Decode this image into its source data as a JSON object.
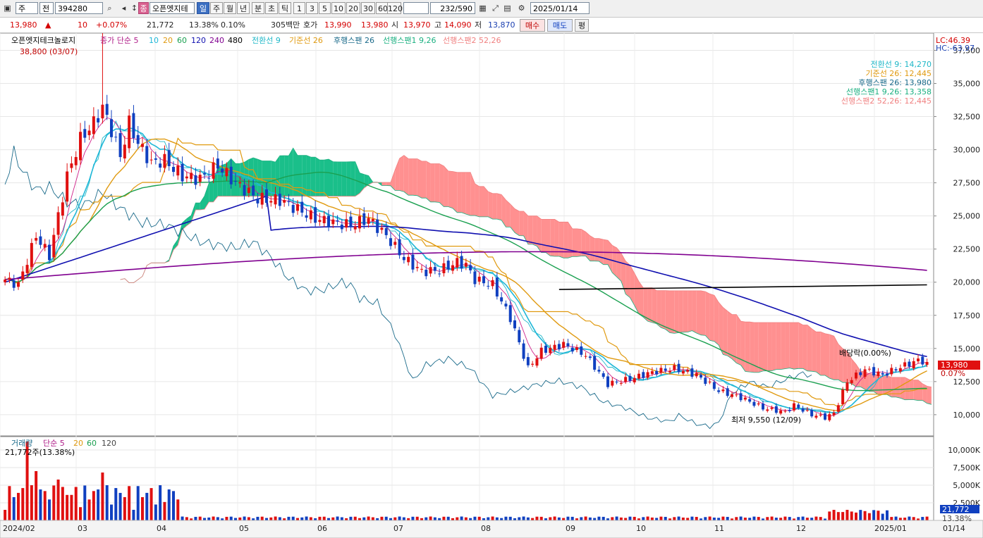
{
  "toolbar": {
    "market": "주",
    "type": "전",
    "code": "394280",
    "name": "오픈엣지테",
    "period_tabs": [
      "일",
      "주",
      "월",
      "년",
      "분",
      "초",
      "틱"
    ],
    "intervals": [
      "1",
      "3",
      "5",
      "10",
      "20",
      "30",
      "60",
      "120"
    ],
    "count": "232",
    "total": "/590",
    "date": "2025/01/14"
  },
  "quote": {
    "price": "13,980",
    "arrow": "▲",
    "change": "10",
    "change_pct": "+0.07%",
    "volume": "21,772",
    "turnover_pct": "13.38%",
    "ratio": "0.10%",
    "amount": "305백만",
    "ask_label": "호가",
    "ask1": "13,990",
    "ask2": "13,980",
    "open_label": "시",
    "open": "13,970",
    "high_label": "고",
    "high": "14,090",
    "low_label": "저",
    "low": "13,870",
    "buy": "매수",
    "sell": "매도",
    "eval": "평"
  },
  "legend": {
    "name": "오픈엣지테크놀로지",
    "ma_label": "종가 단순 5",
    "ma_periods": [
      "10",
      "20",
      "60",
      "120",
      "240",
      "480"
    ],
    "ichimoku": [
      "전환선 9",
      "기준선 26",
      "후행스팬 26",
      "선행스팬1 9,26",
      "선행스팬2 52,26"
    ],
    "max_marker": "38,800 (03/07)",
    "min_marker": "최저 9,550 (12/09)",
    "dividend": "배당락(0.00%)",
    "lc": "LC:46.39",
    "hc": "HC:-63.97"
  },
  "ichimoku_values": [
    {
      "label": "전환선 9: 14,270",
      "color": "#20b8c8"
    },
    {
      "label": "기준선 26: 12,445",
      "color": "#e09a10"
    },
    {
      "label": "후행스팬 26: 13,980",
      "color": "#1a6a8a"
    },
    {
      "label": "선행스팬1 9,26: 13,358",
      "color": "#1ab080"
    },
    {
      "label": "선행스팬2 52,26: 12,445",
      "color": "#f08080"
    }
  ],
  "volume_legend": {
    "label": "거래량",
    "ma": "단순 5",
    "periods": [
      "20",
      "60",
      "120"
    ],
    "current": "21,772주(13.38%)",
    "current_value": "21,772",
    "current_pct": "13.38%"
  },
  "price_tags": {
    "current": "13,980",
    "pct": "0.07%"
  },
  "colors": {
    "up": "#e01010",
    "down": "#1040c0",
    "cloud_up": "#1abf8a",
    "cloud_down": "#ff9090"
  },
  "chart_data": {
    "type": "candlestick",
    "price_axis": {
      "min": 8400,
      "max": 38800,
      "ticks": [
        "37,500",
        "35,000",
        "32,500",
        "30,000",
        "27,500",
        "25,000",
        "22,500",
        "20,000",
        "17,500",
        "15,000",
        "12,500",
        "10,000"
      ]
    },
    "volume_axis": {
      "max": 11500,
      "ticks": [
        "10,000K",
        "7,500K",
        "5,000K",
        "2,500K"
      ]
    },
    "x_labels": [
      "2024/02",
      "03",
      "04",
      "05",
      "06",
      "07",
      "08",
      "09",
      "10",
      "11",
      "12",
      "2025/01",
      "01/14"
    ],
    "close_anchors": [
      [
        0,
        20200
      ],
      [
        3,
        19800
      ],
      [
        7,
        23500
      ],
      [
        10,
        22000
      ],
      [
        14,
        28000
      ],
      [
        17,
        30800
      ],
      [
        20,
        32000
      ],
      [
        22,
        33200
      ],
      [
        24,
        31500
      ],
      [
        26,
        29500
      ],
      [
        28,
        32000
      ],
      [
        30,
        30500
      ],
      [
        33,
        29000
      ],
      [
        36,
        29200
      ],
      [
        40,
        28000
      ],
      [
        44,
        27800
      ],
      [
        48,
        28800
      ],
      [
        52,
        27500
      ],
      [
        57,
        26300
      ],
      [
        62,
        26200
      ],
      [
        66,
        25500
      ],
      [
        70,
        24800
      ],
      [
        74,
        24500
      ],
      [
        78,
        24300
      ],
      [
        82,
        24800
      ],
      [
        86,
        23500
      ],
      [
        90,
        21800
      ],
      [
        94,
        20800
      ],
      [
        98,
        20900
      ],
      [
        102,
        21500
      ],
      [
        104,
        21300
      ],
      [
        106,
        20200
      ],
      [
        110,
        19800
      ],
      [
        114,
        17300
      ],
      [
        118,
        13500
      ],
      [
        121,
        14800
      ],
      [
        126,
        15300
      ],
      [
        131,
        14500
      ],
      [
        136,
        12300
      ],
      [
        141,
        12700
      ],
      [
        146,
        13200
      ],
      [
        151,
        13500
      ],
      [
        156,
        13000
      ],
      [
        161,
        11800
      ],
      [
        166,
        11300
      ],
      [
        171,
        10500
      ],
      [
        176,
        10200
      ],
      [
        178,
        10700
      ],
      [
        182,
        10000
      ],
      [
        185,
        9800
      ],
      [
        187,
        10100
      ],
      [
        190,
        12500
      ],
      [
        194,
        13400
      ],
      [
        198,
        13000
      ],
      [
        202,
        13600
      ],
      [
        206,
        14100
      ],
      [
        208,
        13980
      ]
    ],
    "series": [
      {
        "name": "5",
        "color": "#d0208a"
      },
      {
        "name": "10",
        "color": "#20b8d8"
      },
      {
        "name": "20",
        "color": "#e09a10"
      },
      {
        "name": "60",
        "color": "#1aa050"
      },
      {
        "name": "120",
        "color": "#1010b0"
      },
      {
        "name": "240",
        "color": "#800090"
      },
      {
        "name": "480",
        "color": "#000000"
      }
    ]
  }
}
